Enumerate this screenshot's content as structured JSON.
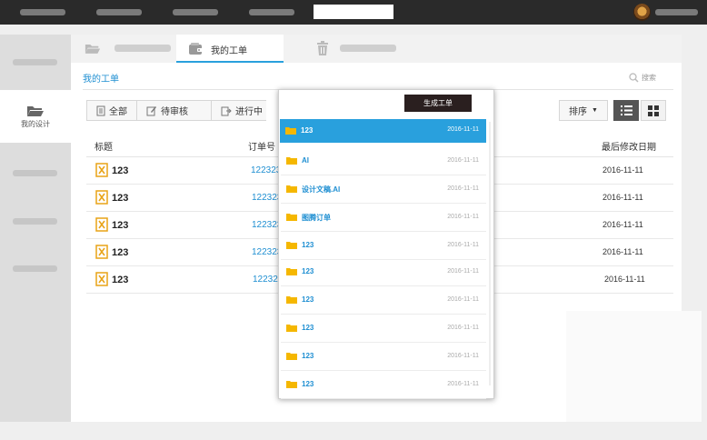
{
  "colors": {
    "accent": "#29a0dd",
    "link": "#1f8fd2",
    "folder": "#f5b700",
    "file_icon": "#e8a317",
    "topbar": "#2a2a2a"
  },
  "sidebar": {
    "active_label": "我的设计"
  },
  "tabs": {
    "my_orders": "我的工单"
  },
  "breadcrumb": "我的工单",
  "search": {
    "label": "搜索"
  },
  "filters": [
    {
      "label": "全部",
      "icon": "document-icon"
    },
    {
      "label": "待审核",
      "icon": "edit-icon"
    },
    {
      "label": "进行中",
      "icon": "export-icon"
    }
  ],
  "sort": {
    "label": "排序"
  },
  "table": {
    "headers": {
      "title": "标题",
      "order_no": "订单号",
      "modified": "最后修改日期"
    },
    "rows": [
      {
        "name": "123",
        "order": "122323",
        "date": "2016-11-11"
      },
      {
        "name": "123",
        "order": "122323",
        "date": "2016-11-11"
      },
      {
        "name": "123",
        "order": "122323",
        "date": "2016-11-11"
      },
      {
        "name": "123",
        "order": "122323",
        "date": "2016-11-11"
      },
      {
        "name": "123",
        "order": "122323",
        "date": "2016-11-11"
      }
    ]
  },
  "dropdown": {
    "generate_label": "生成工单",
    "items": [
      {
        "name": "123",
        "date": "2016-11-11",
        "selected": true
      },
      {
        "name": "AI",
        "date": "2016-11-11"
      },
      {
        "name": "设计文稿.AI",
        "date": "2016-11-11"
      },
      {
        "name": "图腾订单",
        "date": "2016-11-11"
      },
      {
        "name": "123",
        "date": "2016-11-11"
      },
      {
        "name": "123",
        "date": "2016-11-11"
      },
      {
        "name": "123",
        "date": "2016-11-11"
      },
      {
        "name": "123",
        "date": "2016-11-11"
      },
      {
        "name": "123",
        "date": "2016-11-11"
      },
      {
        "name": "123",
        "date": "2016-11-11"
      }
    ]
  }
}
